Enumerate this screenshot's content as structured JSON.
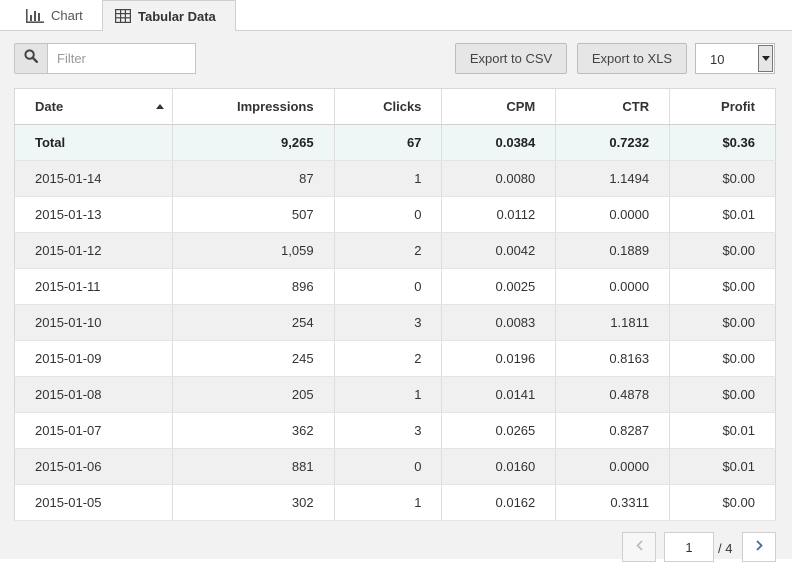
{
  "tabs": [
    {
      "label": "Chart",
      "icon": "bar-chart-icon",
      "active": false
    },
    {
      "label": "Tabular Data",
      "icon": "table-icon",
      "active": true
    }
  ],
  "toolbar": {
    "filter_placeholder": "Filter",
    "filter_value": "",
    "export_csv": "Export to CSV",
    "export_xls": "Export to XLS",
    "page_size": "10"
  },
  "table": {
    "columns": [
      "Date",
      "Impressions",
      "Clicks",
      "CPM",
      "CTR",
      "Profit"
    ],
    "sort_column": "Date",
    "sort_direction": "ascending",
    "total": [
      "Total",
      "9,265",
      "67",
      "0.0384",
      "0.7232",
      "$0.36"
    ],
    "rows": [
      [
        "2015-01-14",
        "87",
        "1",
        "0.0080",
        "1.1494",
        "$0.00"
      ],
      [
        "2015-01-13",
        "507",
        "0",
        "0.0112",
        "0.0000",
        "$0.01"
      ],
      [
        "2015-01-12",
        "1,059",
        "2",
        "0.0042",
        "0.1889",
        "$0.00"
      ],
      [
        "2015-01-11",
        "896",
        "0",
        "0.0025",
        "0.0000",
        "$0.00"
      ],
      [
        "2015-01-10",
        "254",
        "3",
        "0.0083",
        "1.1811",
        "$0.00"
      ],
      [
        "2015-01-09",
        "245",
        "2",
        "0.0196",
        "0.8163",
        "$0.00"
      ],
      [
        "2015-01-08",
        "205",
        "1",
        "0.0141",
        "0.4878",
        "$0.00"
      ],
      [
        "2015-01-07",
        "362",
        "3",
        "0.0265",
        "0.8287",
        "$0.01"
      ],
      [
        "2015-01-06",
        "881",
        "0",
        "0.0160",
        "0.0000",
        "$0.01"
      ],
      [
        "2015-01-05",
        "302",
        "1",
        "0.0162",
        "0.3311",
        "$0.00"
      ]
    ]
  },
  "pagination": {
    "current_page": "1",
    "total_label": "/ 4"
  },
  "colors": {
    "total_row_bg": "#eef6f6",
    "stripe_bg": "#f0f0f0",
    "panel_bg": "#f2f2f2"
  }
}
